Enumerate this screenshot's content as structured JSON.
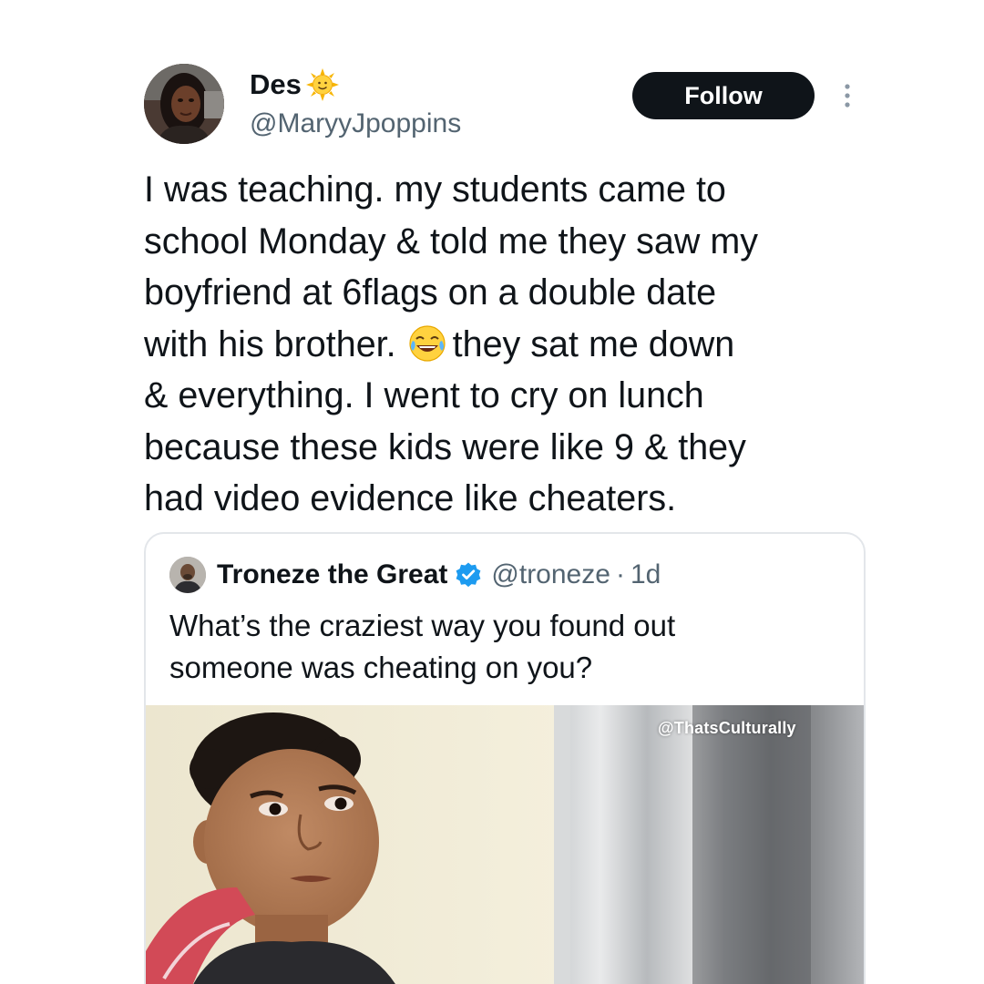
{
  "tweet": {
    "display_name": "Des",
    "name_emoji": "sun-with-face-emoji",
    "handle": "@MaryyJpoppins",
    "follow_label": "Follow",
    "text_lines": [
      "I was teaching.  my students came to",
      "school Monday & told me they saw my",
      "boyfriend at 6flags on a double date",
      "with his brother.",
      "they sat me down",
      "& everything. I went to cry on lunch",
      "because these kids were like 9 & they",
      "had video evidence like cheaters."
    ],
    "inline_emoji": "face-with-tears-of-joy-emoji"
  },
  "quoted": {
    "display_name": "Troneze the Great",
    "verified": true,
    "handle": "@troneze",
    "separator": "·",
    "time": "1d",
    "text_lines": [
      "What’s the craziest way you found out",
      "someone was cheating on you?"
    ],
    "media_description_icon": "photo"
  },
  "watermark": "@ThatsCulturally",
  "colors": {
    "text_primary": "#0f1419",
    "text_secondary": "#536471",
    "follow_bg": "#0f1419",
    "verified_blue": "#1d9bf0",
    "card_border": "#e3e6ea"
  }
}
